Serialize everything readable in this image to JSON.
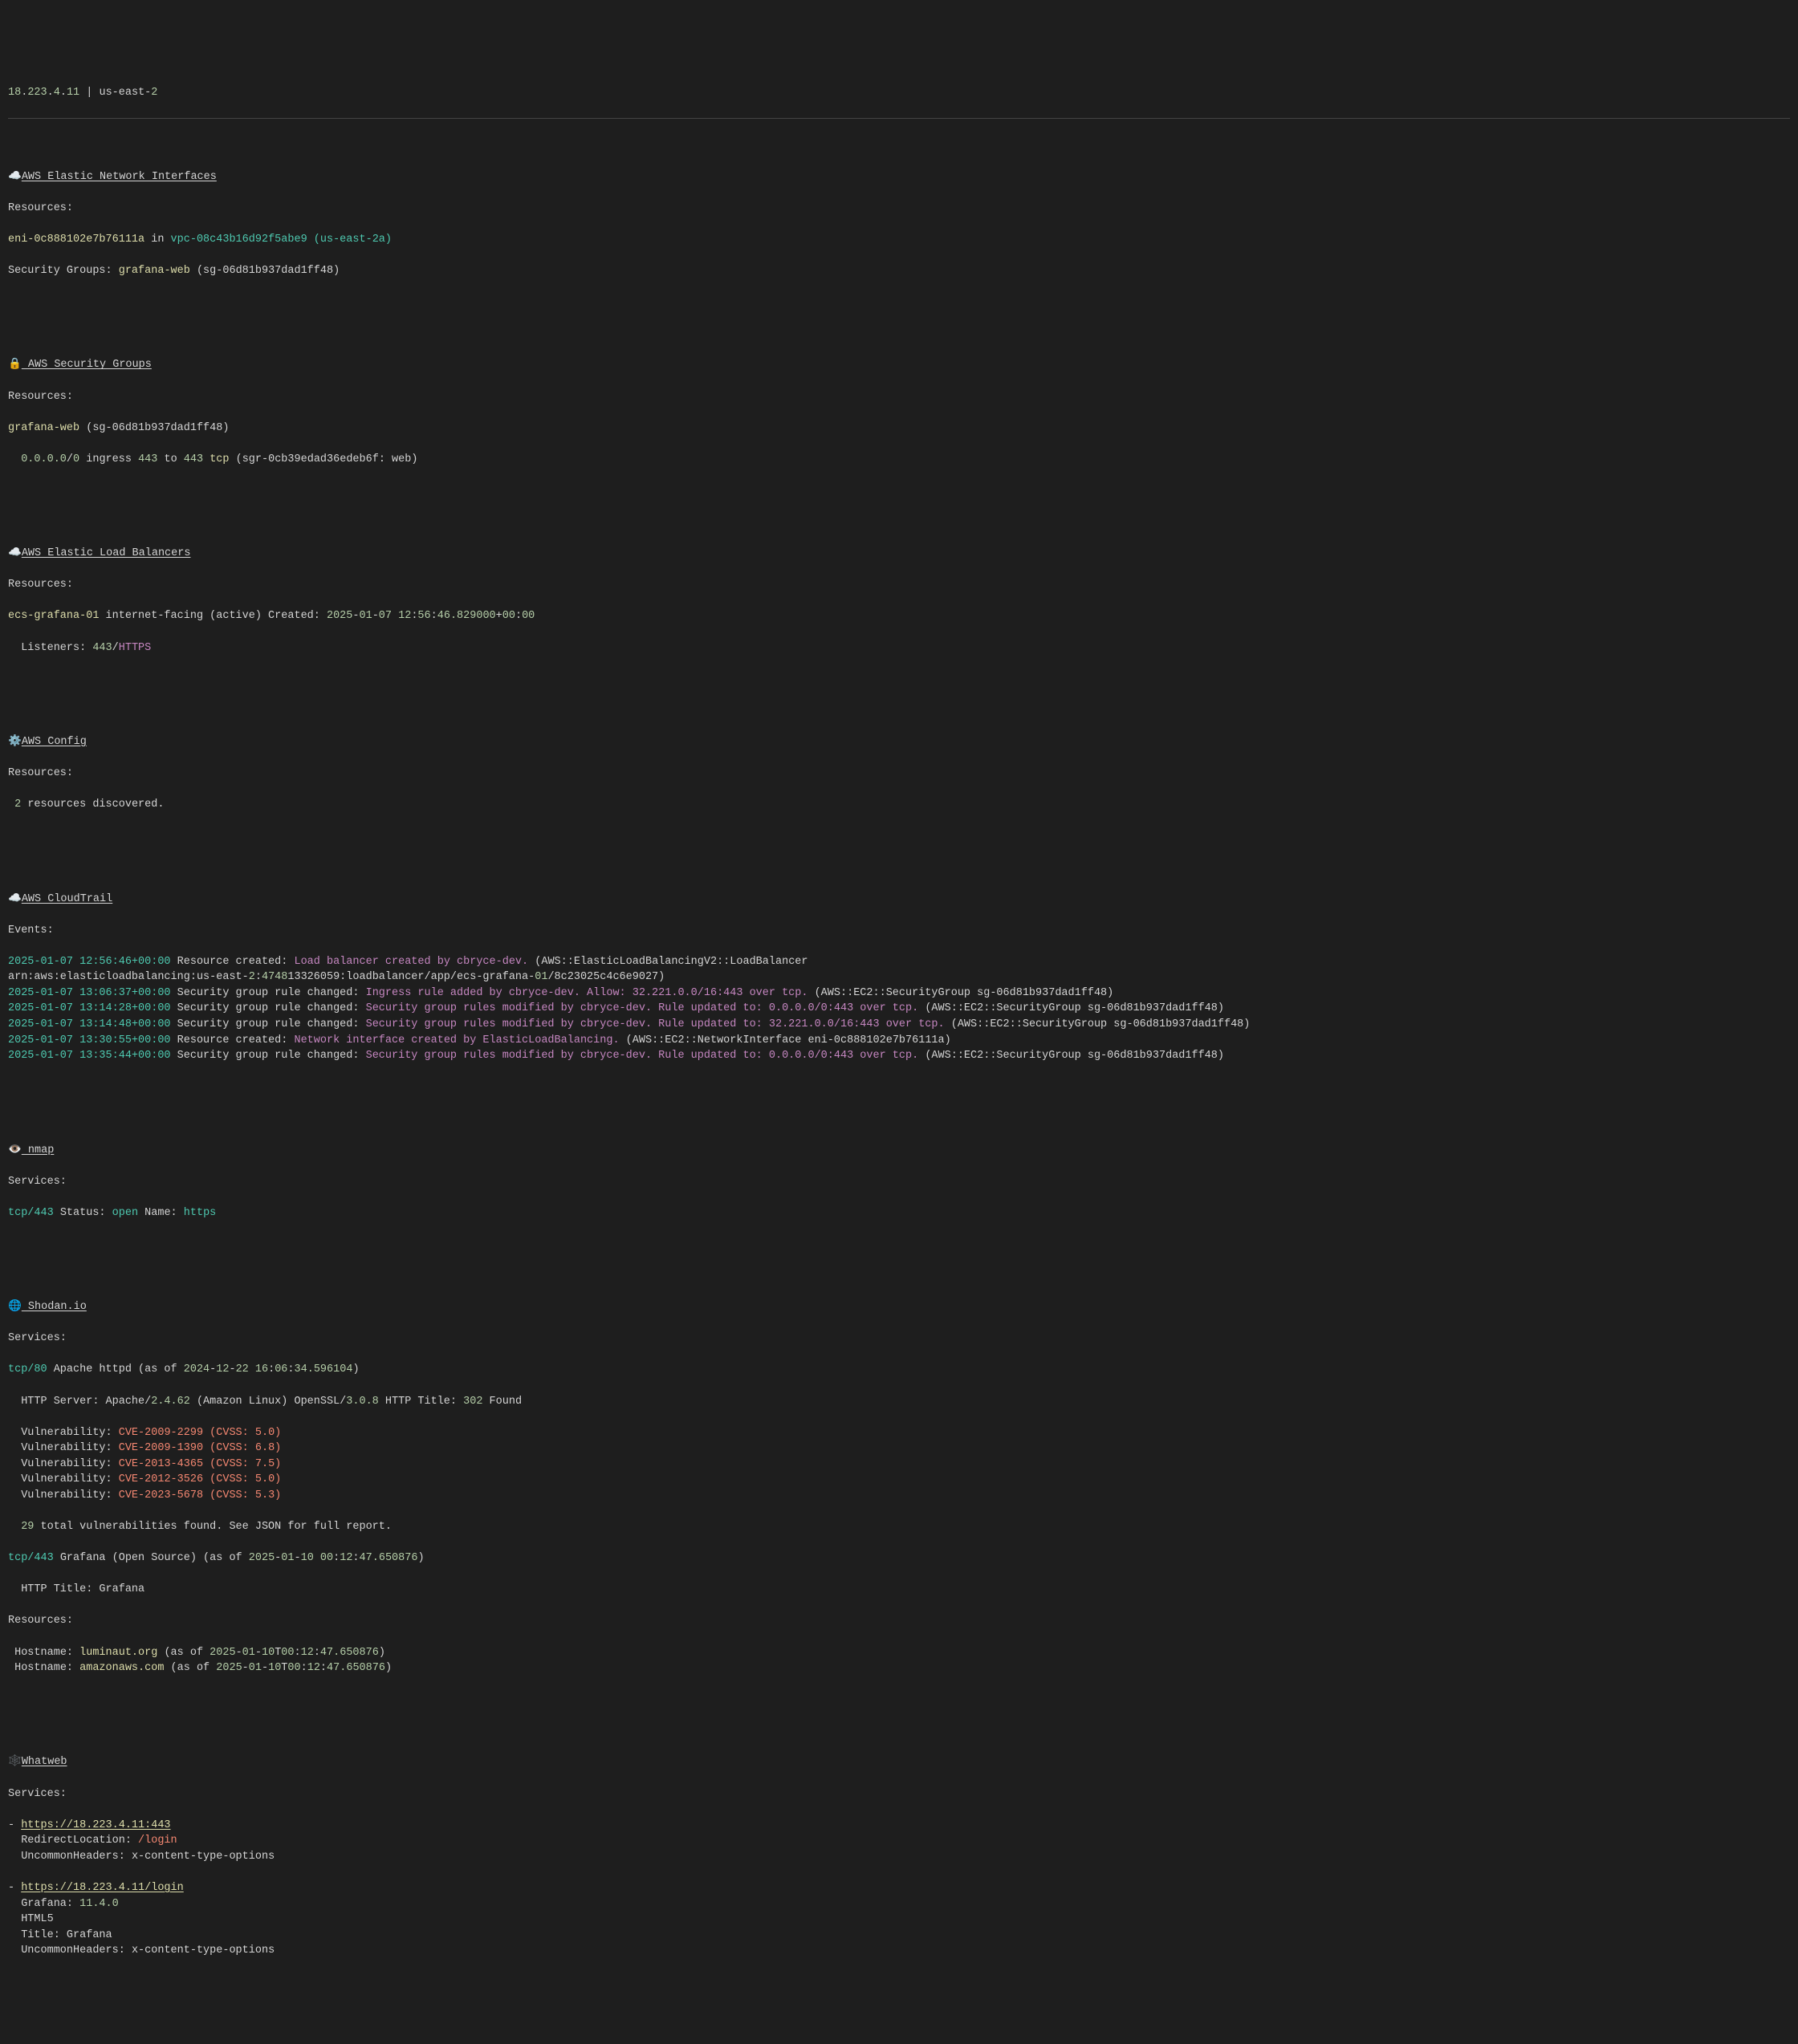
{
  "header": {
    "ip": [
      "18",
      ".",
      "223",
      ".",
      "4",
      ".",
      "11"
    ],
    "sep": " | ",
    "region_pre": "us-east-",
    "region_num": "2"
  },
  "sections": {
    "eni": {
      "icon": "☁️",
      "title": "AWS Elastic Network Interfaces",
      "resources_label": "Resources:",
      "eni_id": "eni-0c888102e7b76111a",
      "in": " in ",
      "vpc": "vpc-08c43b16d92f5abe9 (us-east-2a)",
      "sg_label": "Security Groups: ",
      "sg_name": "grafana-web",
      "sg_id": " (sg-06d81b937dad1ff48)"
    },
    "sg": {
      "icon": "🔒",
      "title": " AWS Security Groups",
      "resources_label": "Resources:",
      "name": "grafana-web",
      "id": " (sg-06d81b937dad1ff48)",
      "bullet": "  ",
      "cidr_pre": "0.0.0.0",
      "cidr_suf": "/",
      "cidr_mask": "0",
      "ingress": " ingress ",
      "port1": "443",
      "to": " to ",
      "port2": "443",
      "proto": " tcp",
      "rule": " (sgr-0cb39edad36edeb6f: web)"
    },
    "elb": {
      "icon": "☁️",
      "title": "AWS Elastic Load Balancers",
      "resources_label": "Resources:",
      "name": "ecs-grafana-01",
      "desc": " internet-facing (active) Created: ",
      "created_parts": [
        "2025",
        "-",
        "01",
        "-",
        "07",
        " ",
        "12",
        ":",
        "56",
        ":",
        "46",
        ".",
        "829000",
        "+",
        "00",
        ":",
        "00"
      ],
      "listeners_label": "  Listeners: ",
      "listener_port": "443",
      "slash": "/",
      "listener_proto": "HTTPS"
    },
    "config": {
      "icon": "⚙️",
      "title": "AWS Config",
      "resources_label": "Resources:",
      "count": "2",
      "text": " resources discovered."
    },
    "cloudtrail": {
      "icon": "☁️",
      "title": "AWS CloudTrail",
      "events_label": "Events:",
      "events": [
        {
          "ts": "2025-01-07 12:56:46+00:00",
          "action": " Resource created: ",
          "detail": "Load balancer created by cbryce-dev.",
          "suffix": " (AWS::ElasticLoadBalancingV2::LoadBalancer",
          "suffix2": ""
        },
        {
          "arn_pre": "arn:aws:elasticloadbalancing:us-east-",
          "arn_mid": "2",
          "arn_colon": ":",
          "arn_acct": "4748",
          "arn_rest": "13326059:loadbalancer/app/ecs-grafana-",
          "arn_num": "01",
          "arn_end": "/8c23025c4c6e9027)"
        },
        {
          "ts": "2025-01-07 13:06:37+00:00",
          "action": " Security group rule changed: ",
          "detail": "Ingress rule added by cbryce-dev. Allow: 32.221.0.0/16:443 over tcp.",
          "suffix": " (AWS::EC2::SecurityGroup sg-06d81b937dad1ff48)"
        },
        {
          "ts": "2025-01-07 13:14:28+00:00",
          "action": " Security group rule changed: ",
          "detail": "Security group rules modified by cbryce-dev. Rule updated to: 0.0.0.0/0:443 over tcp.",
          "suffix": " (AWS::EC2::SecurityGroup sg-06d81b937dad1ff48)"
        },
        {
          "ts": "2025-01-07 13:14:48+00:00",
          "action": " Security group rule changed: ",
          "detail": "Security group rules modified by cbryce-dev. Rule updated to: 32.221.0.0/16:443 over tcp.",
          "suffix": " (AWS::EC2::SecurityGroup sg-06d81b937dad1ff48)"
        },
        {
          "ts": "2025-01-07 13:30:55+00:00",
          "action": " Resource created: ",
          "detail": "Network interface created by ElasticLoadBalancing.",
          "suffix": " (AWS::EC2::NetworkInterface eni-0c888102e7b76111a)"
        },
        {
          "ts": "2025-01-07 13:35:44+00:00",
          "action": " Security group rule changed: ",
          "detail": "Security group rules modified by cbryce-dev. Rule updated to: 0.0.0.0/0:443 over tcp.",
          "suffix": " (AWS::EC2::SecurityGroup sg-06d81b937dad1ff48)"
        }
      ]
    },
    "nmap": {
      "icon": "👁️",
      "title": " nmap",
      "services_label": "Services:",
      "proto_port": "tcp/443",
      "status_label": " Status: ",
      "status": "open",
      "name_label": " Name: ",
      "name": "https"
    },
    "shodan": {
      "icon": "🌐",
      "title": " Shodan.io",
      "services_label": "Services:",
      "svc1_pre": "tcp/",
      "svc1_port": "80",
      "svc1_name": " Apache httpd (as of ",
      "svc1_ts_parts": [
        "2024",
        "-",
        "12",
        "-",
        "22",
        " ",
        "16",
        ":",
        "06",
        ":",
        "34",
        ".",
        "596104"
      ],
      "svc1_close": ")",
      "http_server_line": "  HTTP Server: Apache/",
      "apache_ver": "2.4.62",
      "amzn": " (Amazon Linux) OpenSSL/",
      "openssl_ver": "3.0.8",
      "http_title_pre": " HTTP Title: ",
      "http_title_code": "302",
      "http_title_found": " Found",
      "vulns": [
        {
          "label": "  Vulnerability: ",
          "cve": "CVE-2009-2299 (CVSS: 5.0)"
        },
        {
          "label": "  Vulnerability: ",
          "cve": "CVE-2009-1390 (CVSS: 6.8)"
        },
        {
          "label": "  Vulnerability: ",
          "cve": "CVE-2013-4365 (CVSS: 7.5)"
        },
        {
          "label": "  Vulnerability: ",
          "cve": "CVE-2012-3526 (CVSS: 5.0)"
        },
        {
          "label": "  Vulnerability: ",
          "cve": "CVE-2023-5678 (CVSS: 5.3)"
        }
      ],
      "total_indent": "  ",
      "total_count": "29",
      "total_text": " total vulnerabilities found. See JSON for full report.",
      "svc2_pre": "tcp/",
      "svc2_port": "443",
      "svc2_name": " Grafana (Open Source) (as of ",
      "svc2_ts_parts": [
        "2025",
        "-",
        "01",
        "-",
        "10",
        " ",
        "00",
        ":",
        "12",
        ":",
        "47",
        ".",
        "650876"
      ],
      "svc2_close": ")",
      "svc2_http_title": "  HTTP Title: Grafana",
      "resources_label": "Resources:",
      "hosts": [
        {
          "label": " Hostname: ",
          "name": "luminaut.org",
          "asof": " (as of ",
          "ts": [
            "2025",
            "-",
            "01",
            "-",
            "10",
            "T",
            "00",
            ":",
            "12",
            ":",
            "47",
            ".",
            "650876"
          ],
          "close": ")"
        },
        {
          "label": " Hostname: ",
          "name": "amazonaws.com",
          "asof": " (as of ",
          "ts": [
            "2025",
            "-",
            "01",
            "-",
            "10",
            "T",
            "00",
            ":",
            "12",
            ":",
            "47",
            ".",
            "650876"
          ],
          "close": ")"
        }
      ]
    },
    "whatweb": {
      "icon": "🕸️",
      "title": "Whatweb",
      "services_label": "Services:",
      "entries": [
        {
          "dash": "- ",
          "url": "https://18.223.4.11:443",
          "lines": [
            {
              "label": "  RedirectLocation: ",
              "val": "/login",
              "red": true
            },
            {
              "label": "  UncommonHeaders: ",
              "val": "x-content-type-options",
              "red": false
            }
          ]
        },
        {
          "dash": "- ",
          "url": "https://18.223.4.11/login",
          "lines": [
            {
              "label": "  Grafana: ",
              "val": "11.4.0",
              "numcolor": true
            },
            {
              "label": "  HTML5",
              "val": "",
              "plain": true
            },
            {
              "label": "  Title: ",
              "val": "Grafana"
            },
            {
              "label": "  UncommonHeaders: ",
              "val": "x-content-type-options"
            }
          ]
        }
      ]
    }
  }
}
